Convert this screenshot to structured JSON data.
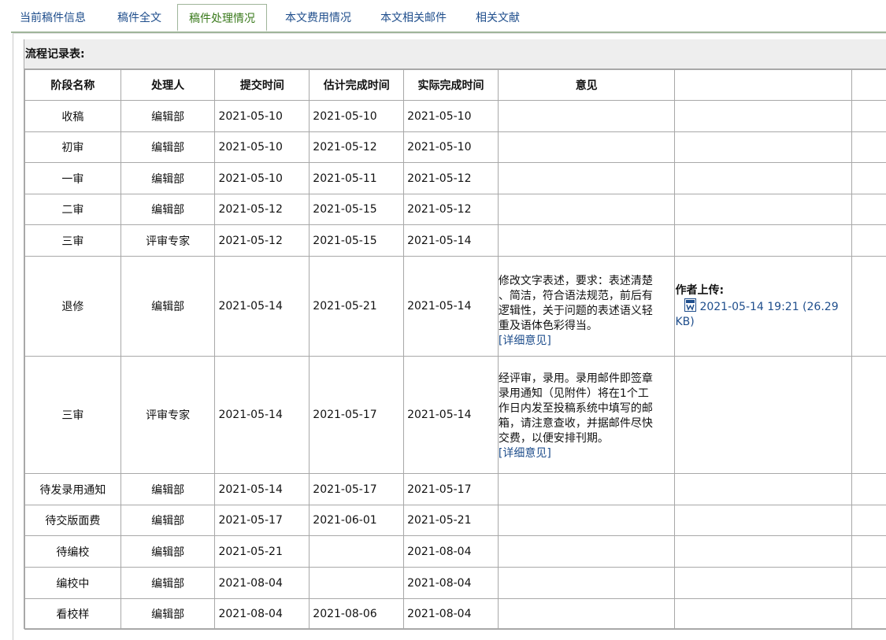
{
  "tabs": [
    {
      "label": "当前稿件信息",
      "active": false
    },
    {
      "label": "稿件全文",
      "active": false
    },
    {
      "label": "稿件处理情况",
      "active": true
    },
    {
      "label": "本文费用情况",
      "active": false
    },
    {
      "label": "本文相关邮件",
      "active": false
    },
    {
      "label": "相关文献",
      "active": false
    }
  ],
  "table_title": "流程记录表:",
  "columns": [
    "阶段名称",
    "处理人",
    "提交时间",
    "估计完成时间",
    "实际完成时间",
    "意见"
  ],
  "rows": [
    {
      "stage": "收稿",
      "handler": "编辑部",
      "submitted": "2021-05-10",
      "estimated": "2021-05-10",
      "actual": "2021-05-10"
    },
    {
      "stage": "初审",
      "handler": "编辑部",
      "submitted": "2021-05-10",
      "estimated": "2021-05-12",
      "actual": "2021-05-10"
    },
    {
      "stage": "一审",
      "handler": "编辑部",
      "submitted": "2021-05-10",
      "estimated": "2021-05-11",
      "actual": "2021-05-12"
    },
    {
      "stage": "二审",
      "handler": "编辑部",
      "submitted": "2021-05-12",
      "estimated": "2021-05-15",
      "actual": "2021-05-12"
    },
    {
      "stage": "三审",
      "handler": "评审专家",
      "submitted": "2021-05-12",
      "estimated": "2021-05-15",
      "actual": "2021-05-14"
    },
    {
      "stage": "退修",
      "handler": "编辑部",
      "submitted": "2021-05-14",
      "estimated": "2021-05-21",
      "actual": "2021-05-14",
      "opinion_lines": [
        "修改文字表述，要求：表述清楚",
        "、简洁，符合语法规范，前后有",
        "逻辑性，关于问题的表述语义轻",
        "重及语体色彩得当。"
      ],
      "detail_link": "[详细意见]",
      "upload_title": "作者上传:",
      "upload_file": "2021-05-14 19:21 (26.29",
      "upload_file_cont": "KB)"
    },
    {
      "stage": "三审",
      "handler": "评审专家",
      "submitted": "2021-05-14",
      "estimated": "2021-05-17",
      "actual": "2021-05-14",
      "opinion_lines": [
        "经评审，录用。录用邮件即签章",
        "录用通知（见附件）将在1个工",
        "作日内发至投稿系统中填写的邮",
        "箱，请注意查收，并据邮件尽快",
        "交费，以便安排刊期。"
      ],
      "detail_link": "[详细意见]"
    },
    {
      "stage": "待发录用通知",
      "handler": "编辑部",
      "submitted": "2021-05-14",
      "estimated": "2021-05-17",
      "actual": "2021-05-17"
    },
    {
      "stage": "待交版面费",
      "handler": "编辑部",
      "submitted": "2021-05-17",
      "estimated": "2021-06-01",
      "actual": "2021-05-21"
    },
    {
      "stage": "待编校",
      "handler": "编辑部",
      "submitted": "2021-05-21",
      "estimated": "",
      "actual": "2021-08-04"
    },
    {
      "stage": "编校中",
      "handler": "编辑部",
      "submitted": "2021-08-04",
      "estimated": "",
      "actual": "2021-08-04"
    },
    {
      "stage": "看校样",
      "handler": "编辑部",
      "submitted": "2021-08-04",
      "estimated": "2021-08-06",
      "actual": "2021-08-04"
    }
  ],
  "icons": {
    "word_doc": "word-document-icon"
  },
  "colors": {
    "link": "#1f4e8c",
    "active_tab": "#3a7a1c",
    "border": "#a8a8a8",
    "caption_bg": "#eeeeee"
  }
}
